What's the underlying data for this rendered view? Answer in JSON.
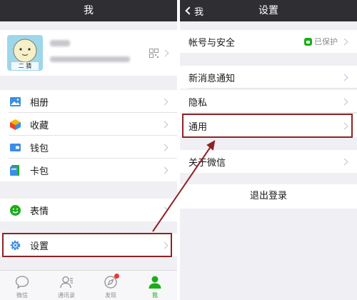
{
  "left": {
    "title": "我",
    "menu": [
      {
        "label": "相册",
        "icon": "photo-album-icon"
      },
      {
        "label": "收藏",
        "icon": "favorites-cube-icon"
      },
      {
        "label": "钱包",
        "icon": "wallet-icon"
      },
      {
        "label": "卡包",
        "icon": "card-pack-icon"
      },
      {
        "label": "表情",
        "icon": "emoji-smile-icon"
      },
      {
        "label": "设置",
        "icon": "settings-gear-icon"
      }
    ],
    "tabs": [
      {
        "label": "微信",
        "icon": "chat-bubble-icon"
      },
      {
        "label": "通讯录",
        "icon": "contacts-icon"
      },
      {
        "label": "发现",
        "icon": "discover-compass-icon"
      },
      {
        "label": "我",
        "icon": "me-person-icon"
      }
    ],
    "avatar_text": "二 猜"
  },
  "right": {
    "title": "设置",
    "back_label": "我",
    "account": {
      "label": "帐号与安全",
      "status": "已保护"
    },
    "items": [
      {
        "label": "新消息通知"
      },
      {
        "label": "隐私"
      },
      {
        "label": "通用"
      },
      {
        "label": "关于微信"
      }
    ],
    "logout": "退出登录"
  },
  "colors": {
    "navbar": "#2e2e33",
    "highlight": "#8e2323",
    "wechat_green": "#1aad19",
    "background": "#efeff4"
  }
}
